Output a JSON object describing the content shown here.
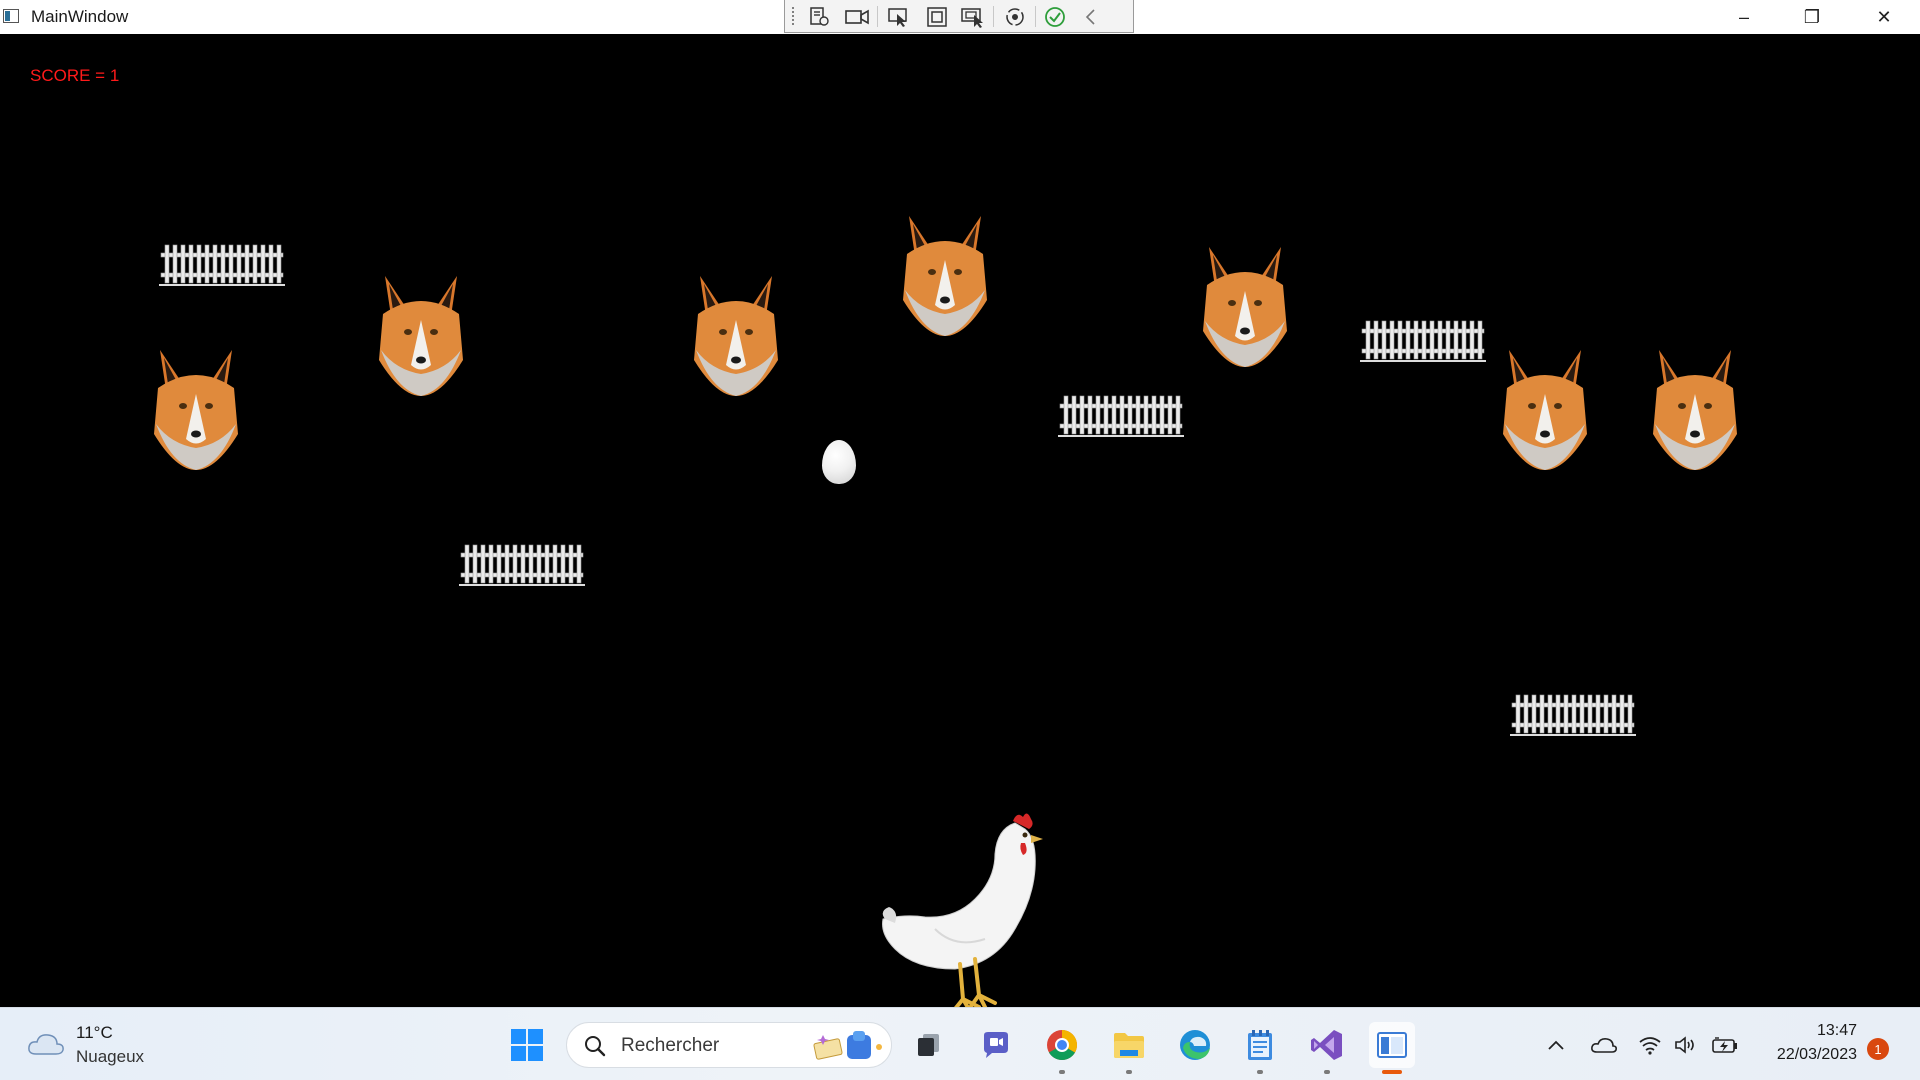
{
  "window": {
    "title": "MainWindow",
    "controls": {
      "minimize": "–",
      "restore": "❐",
      "close": "✕"
    }
  },
  "debug_toolbar": {
    "icons": [
      "live-visual-tree-icon",
      "record-icon",
      "select-element-icon",
      "display-layout-adorners-icon",
      "track-focus-icon",
      "hot-reload-icon",
      "verify-icon",
      "collapse-chevron-icon"
    ]
  },
  "game": {
    "score_text": "SCORE = 1",
    "score_color": "#ff1a1a",
    "background": "#000000",
    "sprites": {
      "foxes": 7,
      "fences": 5,
      "eggs": 1,
      "player": "hen"
    }
  },
  "taskbar": {
    "weather": {
      "temp": "11°C",
      "desc": "Nuageux"
    },
    "search_placeholder": "Rechercher",
    "apps": [
      "windows-start-icon",
      "task-view-icon",
      "teams-chat-icon",
      "chrome-icon",
      "file-explorer-icon",
      "edge-icon",
      "notepad-icon",
      "visual-studio-icon",
      "running-app-icon"
    ],
    "clock": {
      "time": "13:47",
      "date": "22/03/2023"
    },
    "notification_count": "1"
  }
}
